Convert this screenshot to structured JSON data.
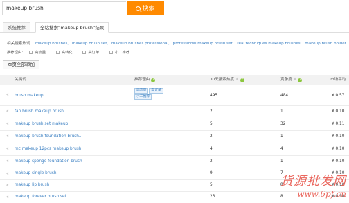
{
  "search": {
    "value": "makeup brush",
    "button_label": "搜索"
  },
  "tabs": [
    "系统推荐",
    "全站搜索“makeup brush”结果"
  ],
  "related": {
    "label": "相关搜索热词：",
    "keywords": [
      "makeup brushes,",
      "makeup brush set,",
      "makeup brushes professional,",
      "professional makeup brush set,",
      "real techniques makeup brushes,",
      "makeup brush holder"
    ]
  },
  "filters": {
    "label": "推荐理由：",
    "options": [
      "高流量",
      "高转化",
      "高订单",
      "小二推荐"
    ]
  },
  "add_all_label": "本页全部添加",
  "headers": {
    "keyword": "关键词",
    "reason": "推荐理由",
    "search_heat": "30天搜索热度",
    "competition": "竞争度",
    "price": "市场平均"
  },
  "rows": [
    {
      "keyword": "brush makeup",
      "tags": [
        "高流量",
        "高订单",
        "小二推荐"
      ],
      "heat": "495",
      "competition": "484",
      "price": "¥ 0.57"
    },
    {
      "keyword": "fan brush makeup brush",
      "tags": [],
      "heat": "2",
      "competition": "1",
      "price": "¥ 0.10"
    },
    {
      "keyword": "makeup brush set makeup",
      "tags": [],
      "heat": "5",
      "competition": "32",
      "price": "¥ 0.11"
    },
    {
      "keyword": "makeup brush foundation brush...",
      "tags": [],
      "heat": "2",
      "competition": "1",
      "price": "¥ 0.10"
    },
    {
      "keyword": "mc makeup 12pcs makeup brush",
      "tags": [],
      "heat": "4",
      "competition": "4",
      "price": "¥ 0.10"
    },
    {
      "keyword": "makeup sponge foundation brush",
      "tags": [],
      "heat": "2",
      "competition": "1",
      "price": "¥ 0.10"
    },
    {
      "keyword": "makeup single brush",
      "tags": [],
      "heat": "9",
      "competition": "7",
      "price": "¥ 0.10"
    },
    {
      "keyword": "makeup lip brush",
      "tags": [],
      "heat": "5",
      "competition": "8",
      "price": "¥ 0.10"
    },
    {
      "keyword": "makeup forever brush set",
      "tags": [],
      "heat": "23",
      "competition": "8",
      "price": "¥ 0.10"
    }
  ],
  "watermark": {
    "title": "货源批发网",
    "url": "www.6pf.cn"
  }
}
